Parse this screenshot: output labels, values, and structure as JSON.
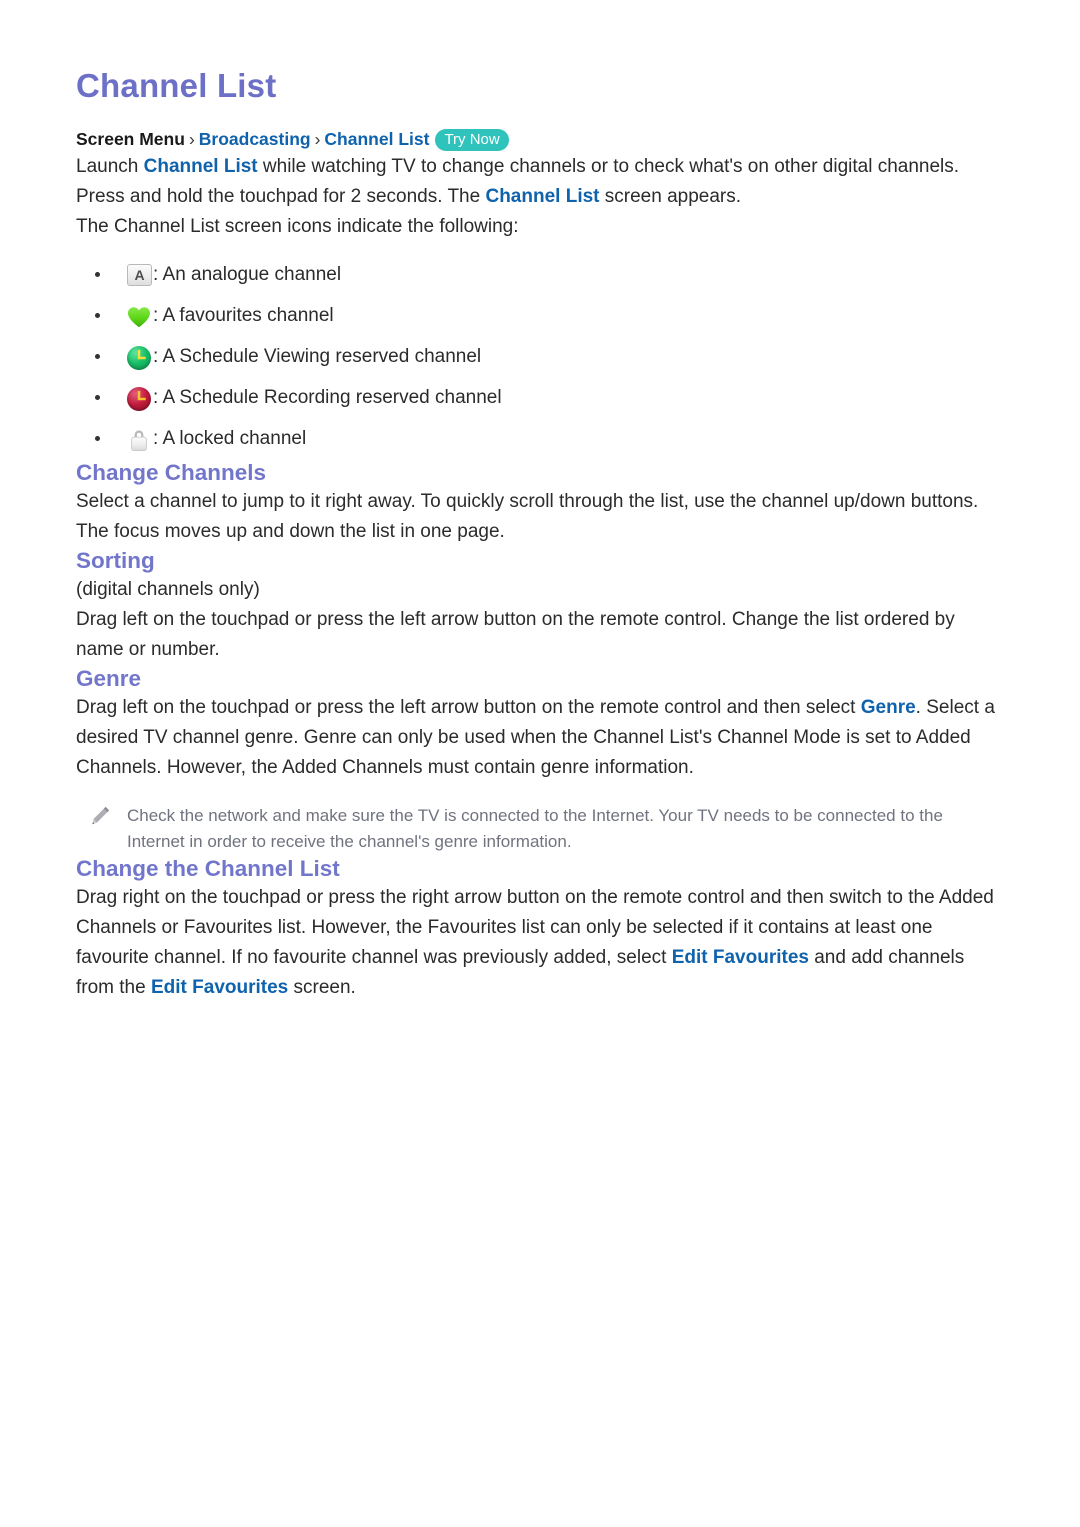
{
  "document": {
    "title": "Channel List"
  },
  "breadcrumb": {
    "root": "Screen Menu",
    "separator": "›",
    "level1": "Broadcasting",
    "level2": "Channel List",
    "badge": "Try Now"
  },
  "intro": {
    "p1_a": "Launch ",
    "p1_link1": "Channel List",
    "p1_b": " while watching TV to change channels or to check what's on other digital channels. Press and hold the touchpad for 2 seconds. The ",
    "p1_link2": "Channel List",
    "p1_c": " screen appears.",
    "p2": "The Channel List screen icons indicate the following:"
  },
  "icon_legend": [
    {
      "icon": "analogue-channel-icon",
      "glyph": "A",
      "separator": ":",
      "label": "An analogue channel"
    },
    {
      "icon": "favourite-heart-icon",
      "glyph": "",
      "separator": ":",
      "label": "A favourites channel"
    },
    {
      "icon": "schedule-viewing-clock-icon",
      "glyph": "",
      "separator": ":",
      "label": "A Schedule Viewing reserved channel"
    },
    {
      "icon": "schedule-recording-clock-icon",
      "glyph": "",
      "separator": ":",
      "label": "A Schedule Recording reserved channel"
    },
    {
      "icon": "locked-channel-padlock-icon",
      "glyph": "",
      "separator": ":",
      "label": "A locked channel"
    }
  ],
  "sections": {
    "change_channels": {
      "heading": "Change Channels",
      "body": "Select a channel to jump to it right away. To quickly scroll through the list, use the channel up/down buttons. The focus moves up and down the list in one page."
    },
    "sorting": {
      "heading": "Sorting",
      "note_line": "(digital channels only)",
      "body": "Drag left on the touchpad or press the left arrow button on the remote control. Change the list ordered by name or number."
    },
    "genre": {
      "heading": "Genre",
      "body_a": "Drag left on the touchpad or press the left arrow button on the remote control and then select ",
      "body_link": "Genre",
      "body_b": ". Select a desired TV channel genre. Genre can only be used when the Channel List's Channel Mode is set to Added Channels. However, the Added Channels must contain genre information.",
      "tip": "Check the network and make sure the TV is connected to the Internet. Your TV needs to be connected to the Internet in order to receive the channel's genre information."
    },
    "change_the_channel_list": {
      "heading": "Change the Channel List",
      "body_a": "Drag right on the touchpad or press the right arrow button on the remote control and then switch to the Added Channels or Favourites list. However, the Favourites list can only be selected if it contains at least one favourite channel. If no favourite channel was previously added, select ",
      "body_link1": "Edit Favourites",
      "body_b": " and add channels from the ",
      "body_link2": "Edit Favourites",
      "body_c": " screen."
    }
  },
  "colors": {
    "title_purple": "#6c70c6",
    "heading_purple": "#7276cb",
    "link_blue": "#0f62ac",
    "badge_teal": "#2fc3bb",
    "body_text": "#2b2b2b",
    "note_text": "#70737f"
  }
}
